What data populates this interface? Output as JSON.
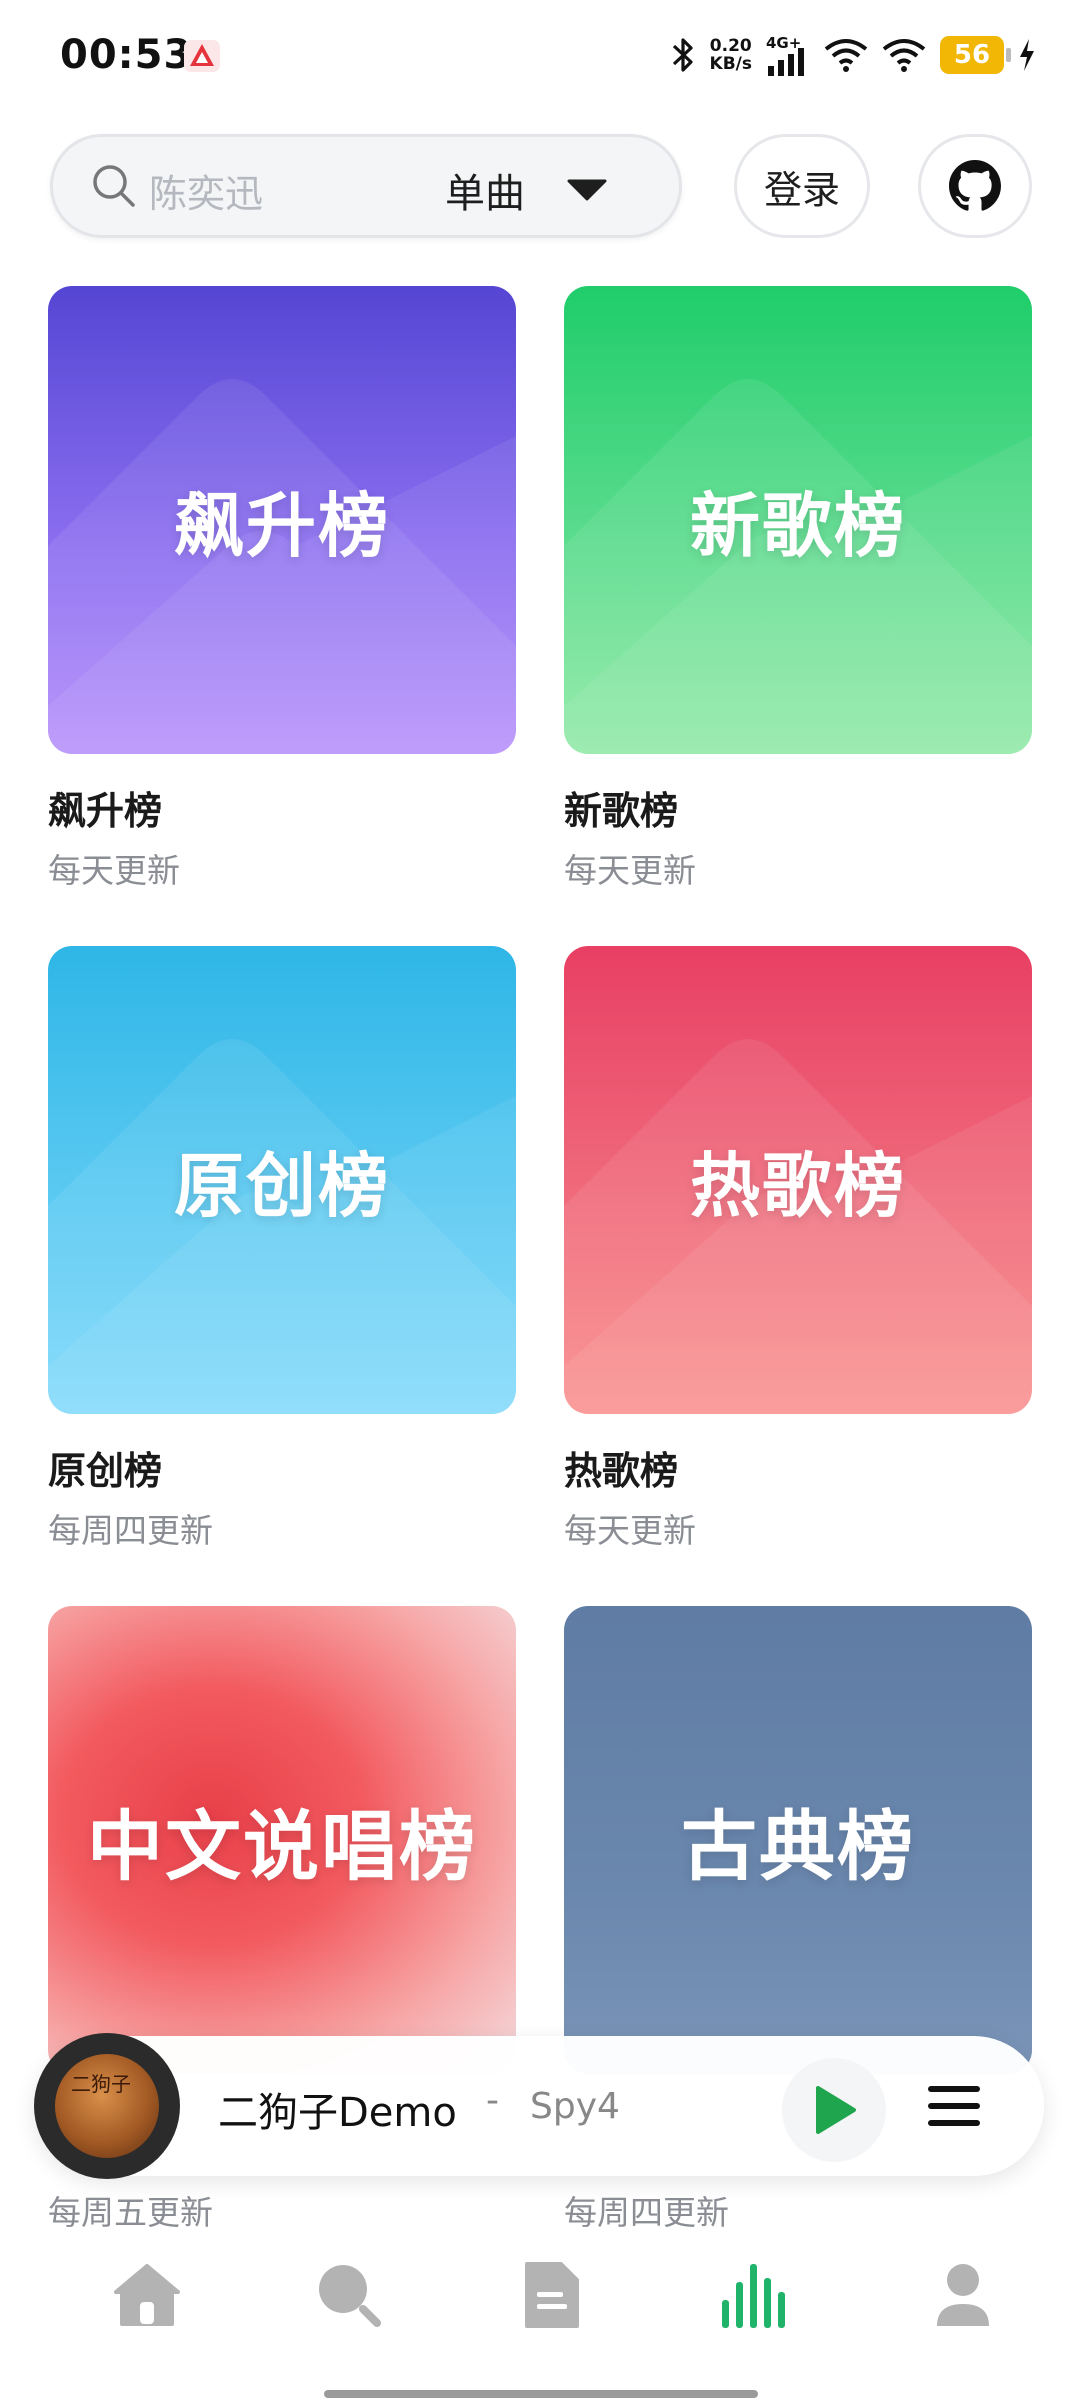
{
  "status_bar": {
    "time": "00:53",
    "net_speed_value": "0.20",
    "net_speed_unit": "KB/s",
    "network_type": "4G+",
    "battery": "56",
    "icons": [
      "bluetooth-icon",
      "signal-icon",
      "wifi-icon",
      "battery-icon",
      "charging-icon"
    ]
  },
  "header": {
    "search_placeholder": "陈奕迅",
    "search_type": "单曲",
    "login_label": "登录",
    "github_icon": "github-icon"
  },
  "charts": [
    {
      "cover_text": "飙升榜",
      "title": "飙升榜",
      "subtitle": "每天更新",
      "color": "#6a55e0"
    },
    {
      "cover_text": "新歌榜",
      "title": "新歌榜",
      "subtitle": "每天更新",
      "color": "#3fd57c"
    },
    {
      "cover_text": "原创榜",
      "title": "原创榜",
      "subtitle": "每周四更新",
      "color": "#45c0ec"
    },
    {
      "cover_text": "热歌榜",
      "title": "热歌榜",
      "subtitle": "每天更新",
      "color": "#ee5a72"
    },
    {
      "cover_text": "中文说唱榜",
      "title": "",
      "subtitle": "每周五更新",
      "color": "#ef4b52"
    },
    {
      "cover_text": "古典榜",
      "title": "",
      "subtitle": "每周四更新",
      "color": "#6783a9"
    }
  ],
  "player": {
    "song": "二狗子Demo",
    "separator": "-",
    "artist": "Spy4",
    "art_text": "二狗子",
    "accent": "#1fa54d"
  },
  "bottom_nav": {
    "items": [
      {
        "name": "home",
        "icon": "home-icon",
        "active": false
      },
      {
        "name": "search",
        "icon": "search-icon",
        "active": false
      },
      {
        "name": "document",
        "icon": "document-icon",
        "active": false
      },
      {
        "name": "charts",
        "icon": "bar-chart-icon",
        "active": true
      },
      {
        "name": "profile",
        "icon": "user-icon",
        "active": false
      }
    ],
    "active_color": "#1fb46a",
    "inactive_color": "#b3b3b3"
  }
}
